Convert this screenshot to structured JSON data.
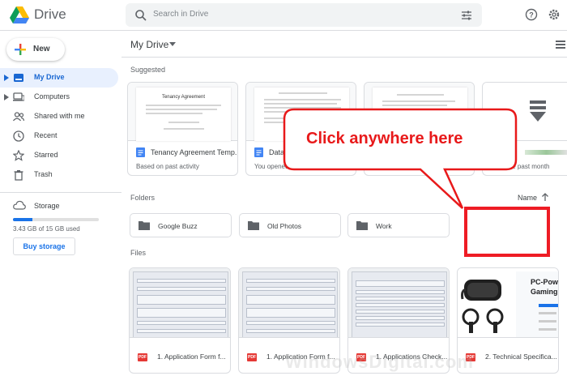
{
  "app": {
    "title": "Drive"
  },
  "search": {
    "placeholder": "Search in Drive"
  },
  "sidebar": {
    "new_label": "New",
    "items": [
      {
        "label": "My Drive",
        "icon": "my-drive-icon",
        "active": true
      },
      {
        "label": "Computers",
        "icon": "computers-icon"
      },
      {
        "label": "Shared with me",
        "icon": "shared-icon"
      },
      {
        "label": "Recent",
        "icon": "clock-icon"
      },
      {
        "label": "Starred",
        "icon": "star-icon"
      },
      {
        "label": "Trash",
        "icon": "trash-icon"
      }
    ],
    "storage_label": "Storage",
    "storage_used_text": "3.43 GB of 15 GB used",
    "storage_fraction": 0.23,
    "buy_storage": "Buy storage"
  },
  "main": {
    "breadcrumb": "My Drive",
    "suggested_title": "Suggested",
    "suggested": [
      {
        "name": "Tenancy Agreement Temp...",
        "sub": "Based on past activity",
        "doc_heading": "Tenancy Agreement"
      },
      {
        "name": "Datap",
        "sub": "You opened"
      },
      {
        "name": "",
        "sub": ""
      },
      {
        "name": "",
        "sub": "ed in the past month"
      }
    ],
    "folders_title": "Folders",
    "sort_label": "Name",
    "folders": [
      {
        "name": "Google Buzz"
      },
      {
        "name": "Old Photos"
      },
      {
        "name": "Work"
      }
    ],
    "files_title": "Files",
    "files": [
      {
        "name": "1. Application Form f..."
      },
      {
        "name": "1. Application Form f..."
      },
      {
        "name": "1. Applications Check..."
      },
      {
        "name": "2. Technical Specifica..."
      }
    ],
    "ad_text": {
      "line1": "PC-Pow",
      "line2": "Gaming"
    }
  },
  "overlay": {
    "callout_text": "Click anywhere here",
    "watermark": "WindowsDigital.com"
  },
  "colors": {
    "accent": "#1a73e8",
    "callout_red": "#e8191a",
    "box_red": "#ee1c25"
  }
}
